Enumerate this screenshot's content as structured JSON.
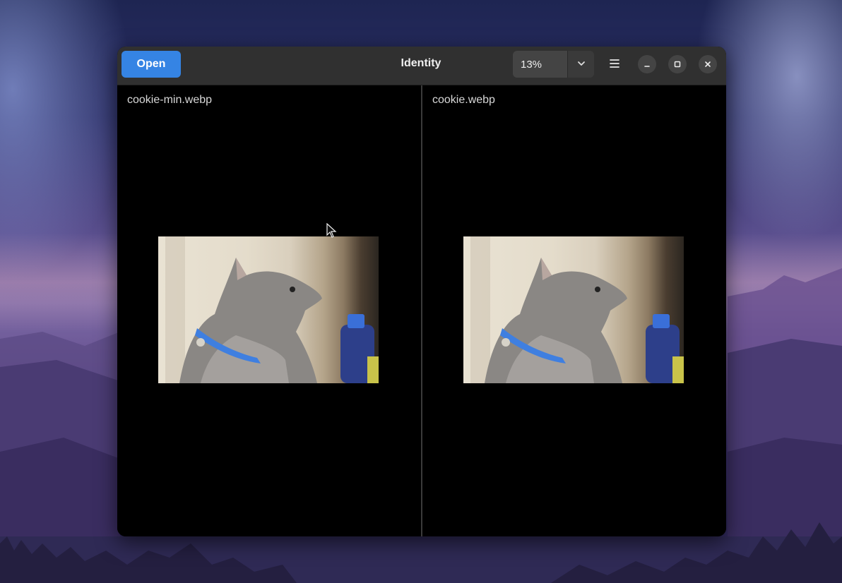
{
  "window": {
    "title": "Identity",
    "open_label": "Open",
    "zoom_value": "13%",
    "icons": {
      "zoom_dropdown": "chevron-down-icon",
      "menu": "hamburger-menu-icon",
      "minimize": "minimize-icon",
      "maximize": "maximize-icon",
      "close": "close-icon"
    }
  },
  "panes": [
    {
      "filename": "cookie-min.webp"
    },
    {
      "filename": "cookie.webp"
    }
  ],
  "colors": {
    "accent": "#3584e4",
    "headerbar": "#303030",
    "canvas": "#000000"
  }
}
